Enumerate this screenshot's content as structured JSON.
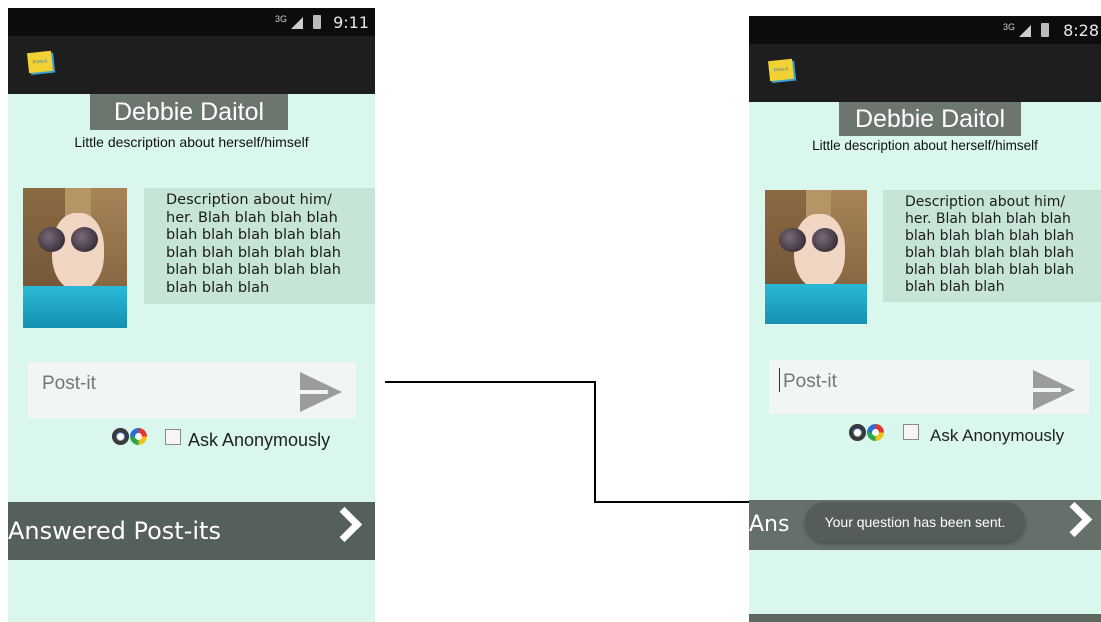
{
  "left_screen": {
    "status_time": "9:11",
    "network": "3G",
    "profile_name": "Debbie Daitol",
    "subtitle": "Little description about herself/himself",
    "description": "Description about him/\nher. Blah blah blah blah\nblah blah blah blah blah\nblah blah blah blah blah\nblah blah blah blah blah\nblah blah blah",
    "post_placeholder": "Post-it",
    "ask_anonymously": "Ask Anonymously",
    "answered_label": "Answered Post-its"
  },
  "right_screen": {
    "status_time": "8:28",
    "network": "3G",
    "profile_name": "Debbie Daitol",
    "subtitle": "Little description about herself/himself",
    "description": "Description about him/\nher. Blah blah blah blah\nblah blah blah blah blah\nblah blah blah blah blah\nblah blah blah blah blah\nblah blah blah",
    "post_placeholder": "Post-it",
    "ask_anonymously": "Ask Anonymously",
    "answered_label": "Ans",
    "toast": "Your question has been sent."
  },
  "icons": [
    "logo-icon",
    "send-icon",
    "color-wheel-icon",
    "chevron-right-icon",
    "signal-icon",
    "battery-icon"
  ],
  "colors": {
    "screen_bg": "#d9f7ec",
    "action_bar": "#1e1e1e",
    "banner": "#6c756e",
    "answered_bar": "#55605a"
  }
}
